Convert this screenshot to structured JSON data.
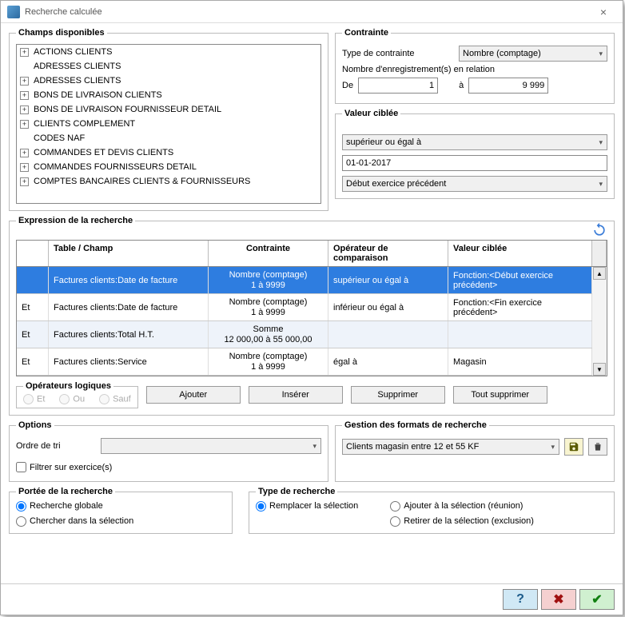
{
  "window": {
    "title": "Recherche calculée"
  },
  "champs": {
    "legend": "Champs disponibles",
    "items": [
      {
        "label": "ACTIONS CLIENTS",
        "expandable": true
      },
      {
        "label": "ADRESSES CLIENTS",
        "expandable": false
      },
      {
        "label": "ADRESSES CLIENTS",
        "expandable": true
      },
      {
        "label": "BONS DE LIVRAISON CLIENTS",
        "expandable": true
      },
      {
        "label": "BONS DE LIVRAISON FOURNISSEUR DETAIL",
        "expandable": true
      },
      {
        "label": "CLIENTS COMPLEMENT",
        "expandable": true
      },
      {
        "label": "CODES NAF",
        "expandable": false
      },
      {
        "label": "COMMANDES ET DEVIS CLIENTS",
        "expandable": true
      },
      {
        "label": "COMMANDES FOURNISSEURS DETAIL",
        "expandable": true
      },
      {
        "label": "COMPTES BANCAIRES CLIENTS & FOURNISSEURS",
        "expandable": true
      }
    ]
  },
  "contrainte": {
    "legend": "Contrainte",
    "type_label": "Type de contrainte",
    "type_value": "Nombre (comptage)",
    "nb_label": "Nombre d'enregistrement(s) en relation",
    "de_label": "De",
    "de_value": "1",
    "a_label": "à",
    "a_value": "9 999"
  },
  "valeur": {
    "legend": "Valeur ciblée",
    "operator": "supérieur ou égal à",
    "date": "01-01-2017",
    "function": "Début exercice précédent"
  },
  "expression": {
    "legend": "Expression de la recherche",
    "headers": {
      "c1": "Table / Champ",
      "c2": "Contrainte",
      "c3": "Opérateur de comparaison",
      "c4": "Valeur ciblée"
    },
    "rows": [
      {
        "op": "",
        "field": "Factures clients:Date de facture",
        "c2a": "Nombre (comptage)",
        "c2b": "1 à 9999",
        "c3": "supérieur ou égal à",
        "c4": "Fonction:<Début exercice précédent>",
        "selected": true
      },
      {
        "op": "Et",
        "field": "Factures clients:Date de facture",
        "c2a": "Nombre (comptage)",
        "c2b": "1 à 9999",
        "c3": "inférieur ou égal à",
        "c4": "Fonction:<Fin exercice précédent>",
        "selected": false
      },
      {
        "op": "Et",
        "field": "Factures clients:Total H.T.",
        "c2a": "Somme",
        "c2b": "12 000,00 à 55 000,00",
        "c3": "",
        "c4": "",
        "selected": false,
        "alt": true
      },
      {
        "op": "Et",
        "field": "Factures clients:Service",
        "c2a": "Nombre (comptage)",
        "c2b": "1 à 9999",
        "c3": "égal à",
        "c4": "Magasin",
        "selected": false
      }
    ]
  },
  "logical_ops": {
    "legend": "Opérateurs logiques",
    "et": "Et",
    "ou": "Ou",
    "sauf": "Sauf"
  },
  "buttons": {
    "ajouter": "Ajouter",
    "inserer": "Insérer",
    "supprimer": "Supprimer",
    "tout_supprimer": "Tout supprimer"
  },
  "options": {
    "legend": "Options",
    "ordre_label": "Ordre de tri",
    "ordre_value": "",
    "filtrer_label": "Filtrer sur exercice(s)"
  },
  "gestion": {
    "legend": "Gestion des formats de recherche",
    "value": "Clients magasin entre 12 et 55 KF"
  },
  "portee": {
    "legend": "Portée de la recherche",
    "globale": "Recherche globale",
    "selection": "Chercher dans la sélection"
  },
  "type_recherche": {
    "legend": "Type de recherche",
    "remplacer": "Remplacer la sélection",
    "ajouter": "Ajouter à la sélection (réunion)",
    "retirer": "Retirer de la sélection (exclusion)"
  },
  "dialog": {
    "help": "?",
    "cancel": "✖",
    "ok": "✔"
  }
}
